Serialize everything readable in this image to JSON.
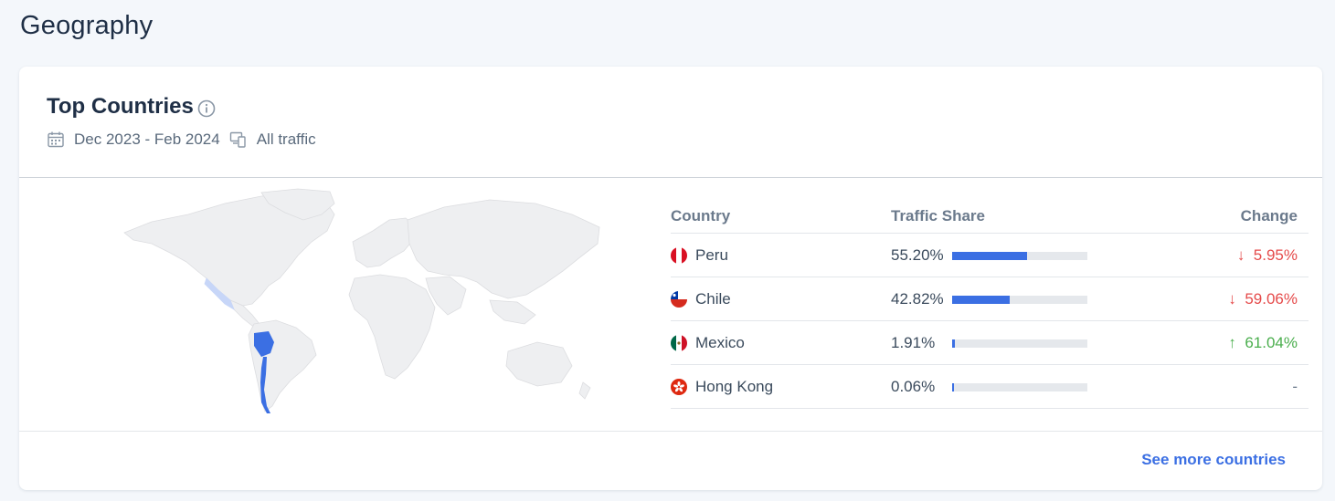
{
  "page": {
    "title": "Geography"
  },
  "card": {
    "title": "Top Countries",
    "date_range": "Dec 2023 - Feb 2024",
    "traffic_type": "All traffic",
    "icons": {
      "info": "info-icon",
      "calendar": "calendar-icon",
      "devices": "devices-icon"
    }
  },
  "table": {
    "headers": {
      "country": "Country",
      "share": "Traffic Share",
      "change": "Change"
    },
    "rows": [
      {
        "country": "Peru",
        "share": "55.20%",
        "share_fraction": 0.552,
        "change": "5.95%",
        "direction": "down",
        "flag": "peru-flag"
      },
      {
        "country": "Chile",
        "share": "42.82%",
        "share_fraction": 0.4282,
        "change": "59.06%",
        "direction": "down",
        "flag": "chile-flag"
      },
      {
        "country": "Mexico",
        "share": "1.91%",
        "share_fraction": 0.0191,
        "change": "61.04%",
        "direction": "up",
        "flag": "mexico-flag"
      },
      {
        "country": "Hong Kong",
        "share": "0.06%",
        "share_fraction": 0.0006,
        "change": "-",
        "direction": "none",
        "flag": "hong-kong-flag"
      }
    ]
  },
  "footer": {
    "see_more": "See more countries"
  },
  "colors": {
    "accent": "#3b6fe3",
    "down": "#e54b4b",
    "up": "#4aae4d",
    "highlight_map": "#3b6fe3"
  }
}
